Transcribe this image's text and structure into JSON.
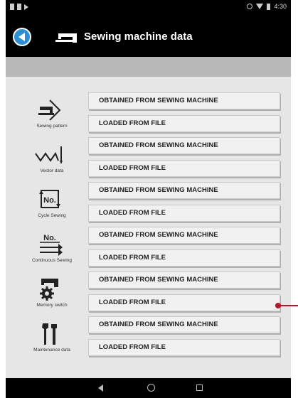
{
  "status_bar": {
    "time": "4:30"
  },
  "header": {
    "title": "Sewing machine data",
    "back_icon": "back-arrow-icon",
    "title_icon": "sewing-machine-icon"
  },
  "colors": {
    "accent": "#2d8fd6",
    "pointer": "#b5152b",
    "content_bg": "#e6e6e6"
  },
  "groups": [
    {
      "label": "Sewing pattern",
      "icon": "sewing-pattern-icon",
      "obtained": "OBTAINED FROM SEWING MACHINE",
      "loaded": "LOADED FROM FILE"
    },
    {
      "label": "Vector data",
      "icon": "vector-data-icon",
      "obtained": "OBTAINED FROM SEWING MACHINE",
      "loaded": "LOADED FROM FILE"
    },
    {
      "label": "Cycle Sewing",
      "icon": "cycle-sewing-icon",
      "icon_text": "No.",
      "obtained": "OBTAINED FROM SEWING MACHINE",
      "loaded": "LOADED FROM FILE"
    },
    {
      "label": "Continuous Sewing",
      "icon": "continuous-sewing-icon",
      "icon_text": "No.",
      "obtained": "OBTAINED FROM SEWING MACHINE",
      "loaded": "LOADED FROM FILE"
    },
    {
      "label": "Memory switch",
      "icon": "memory-switch-icon",
      "obtained": "OBTAINED FROM SEWING MACHINE",
      "loaded": "LOADED FROM FILE"
    },
    {
      "label": "Maintenance data",
      "icon": "maintenance-icon",
      "obtained": "OBTAINED FROM SEWING MACHINE",
      "loaded": "LOADED FROM FILE"
    }
  ]
}
